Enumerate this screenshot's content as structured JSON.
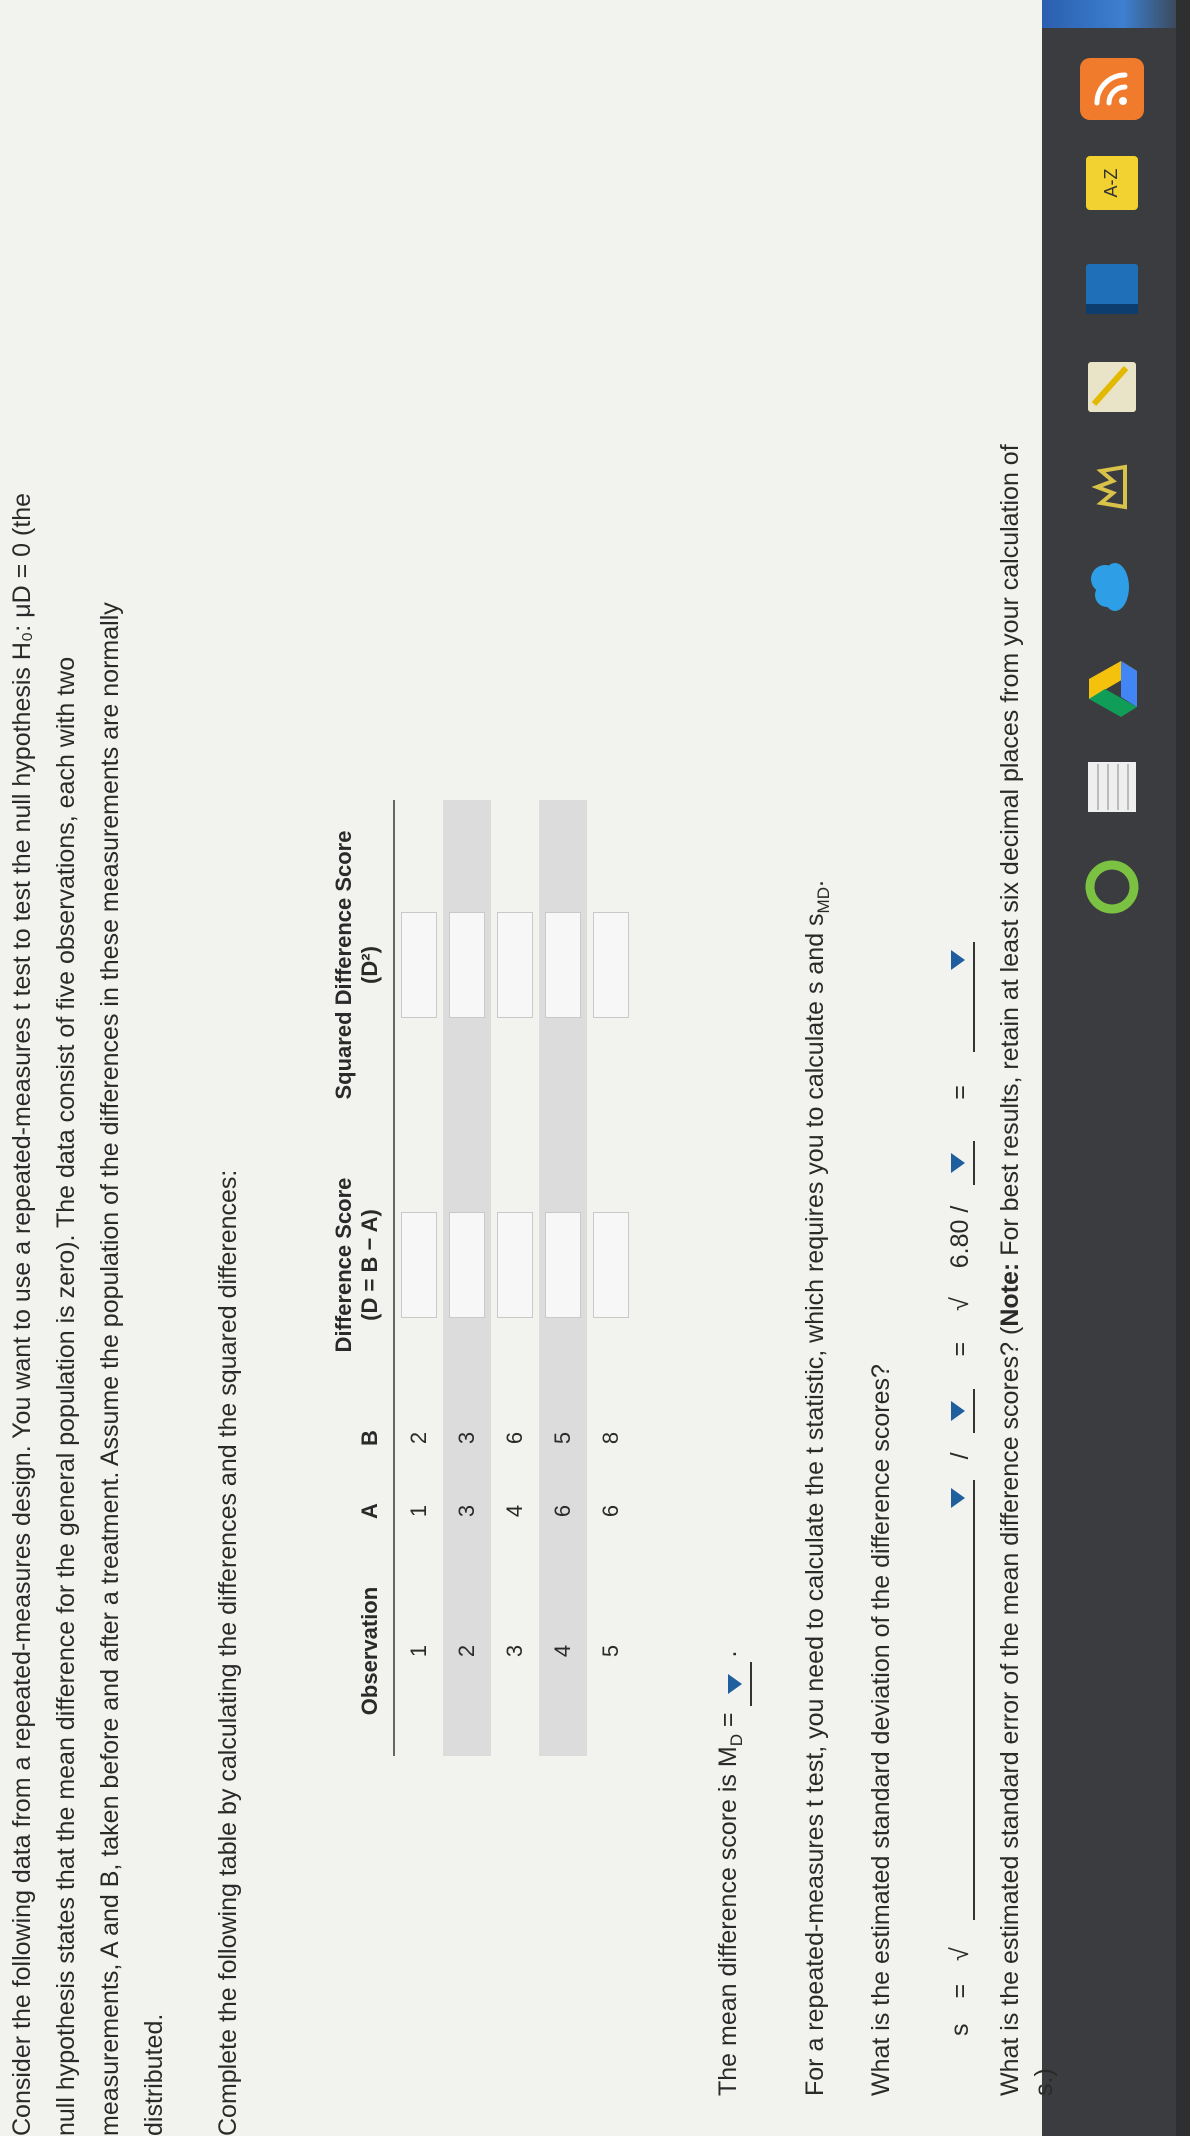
{
  "taskbar": {
    "icons": [
      "wifi-icon",
      "a-z-icon",
      "book-icon",
      "notepad-icon",
      "crown-icon",
      "cloud-icon",
      "drive-icon",
      "document-icon",
      "ring-icon"
    ],
    "az_label": "A-Z"
  },
  "intro": {
    "line1": "Consider the following data from a repeated-measures design. You want to use a repeated-measures t test to test the null hypothesis H₀: μD = 0 (the",
    "line2": "null hypothesis states that the mean difference for the general population is zero). The data consist of five observations, each with two",
    "line3": "measurements, A and B, taken before and after a treatment. Assume the population of the differences in these measurements are normally",
    "line4": "distributed."
  },
  "instruction": "Complete the following table by calculating the differences and the squared differences:",
  "table": {
    "headers": {
      "observation": "Observation",
      "a": "A",
      "b": "B",
      "diff_top": "Difference Score",
      "diff_bottom": "(D = B − A)",
      "sq_top": "Squared Difference Score",
      "sq_bottom": "(D²)"
    },
    "rows": [
      {
        "obs": "1",
        "a": "1",
        "b": "2"
      },
      {
        "obs": "2",
        "a": "3",
        "b": "3"
      },
      {
        "obs": "3",
        "a": "4",
        "b": "6"
      },
      {
        "obs": "4",
        "a": "6",
        "b": "5"
      },
      {
        "obs": "5",
        "a": "6",
        "b": "8"
      }
    ]
  },
  "mean_question": "The mean difference score is M",
  "mean_sub": "D",
  "mean_eq": " = ",
  "mean_tail": ".",
  "repeated_text": "For a repeated-measures t test, you need to calculate the t statistic, which requires you to calculate s and s",
  "repeated_sub": "MD",
  "repeated_tail": ".",
  "sd_question": "What is the estimated standard deviation of the difference scores?",
  "formula": {
    "s": "s",
    "eq1": "=",
    "sqrt1": "√",
    "slash1": "/",
    "eq2": "=",
    "sqrt2": "√",
    "value": "6.80 /",
    "eq3": "="
  },
  "se_question_prefix": "What is the estimated standard error of the mean difference scores? (",
  "se_note_label": "Note:",
  "se_question_rest": " For best results, retain at least six decimal places from your calculation of",
  "se_question_line2": "s.)"
}
